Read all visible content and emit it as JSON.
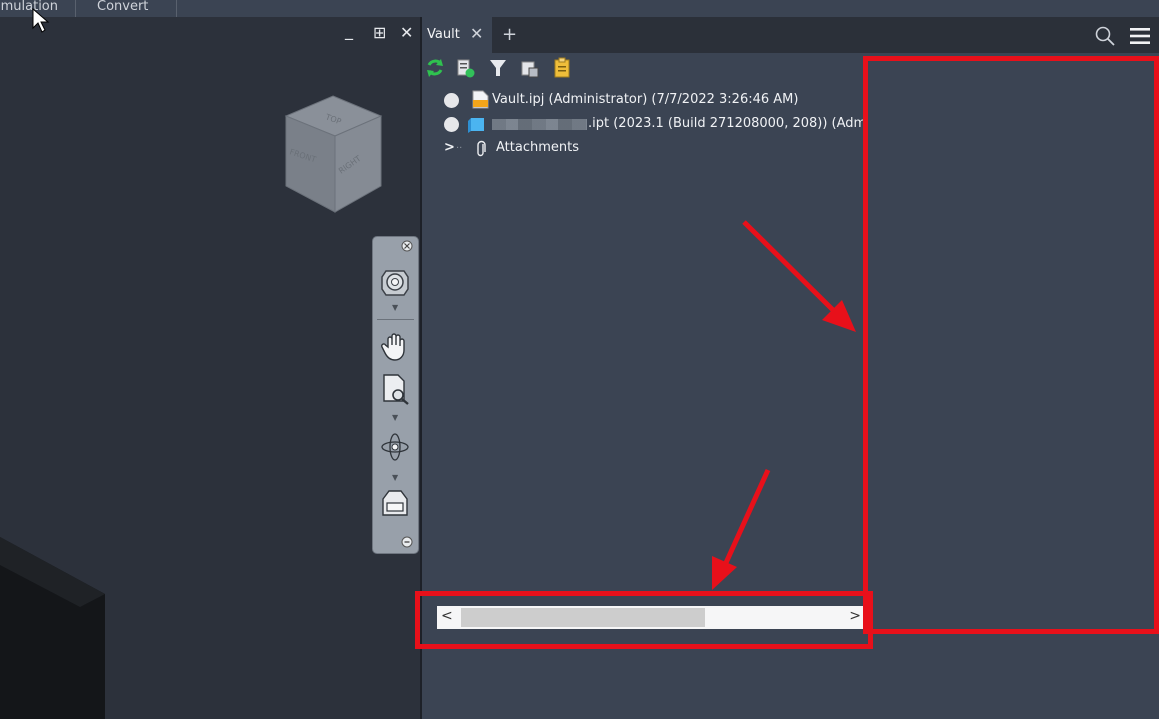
{
  "ribbon": {
    "tabs": [
      {
        "label": "imulation"
      },
      {
        "label": "Convert"
      }
    ]
  },
  "viewport": {
    "controls": {
      "minimize": "_",
      "restore": "⊞",
      "close": "✕"
    },
    "viewcube": {
      "top": "TOP",
      "front": "FRONT",
      "right": "RIGHT"
    }
  },
  "vault": {
    "tab": {
      "label": "Vault",
      "close": "✕",
      "add": "+"
    },
    "tree": [
      {
        "label": "Vault.ipj (Administrator) (7/7/2022 3:26:46 AM)"
      },
      {
        "label": ".ipt (2023.1 (Build 271208000, 208)) (Adm"
      },
      {
        "label": "Attachments",
        "expander": ">"
      }
    ],
    "scrollbar": {
      "left": "<",
      "right": ">"
    }
  },
  "colors": {
    "accent_red": "#e8101a",
    "panel_bg": "#3b4453",
    "viewport_bg": "#2c313b"
  }
}
